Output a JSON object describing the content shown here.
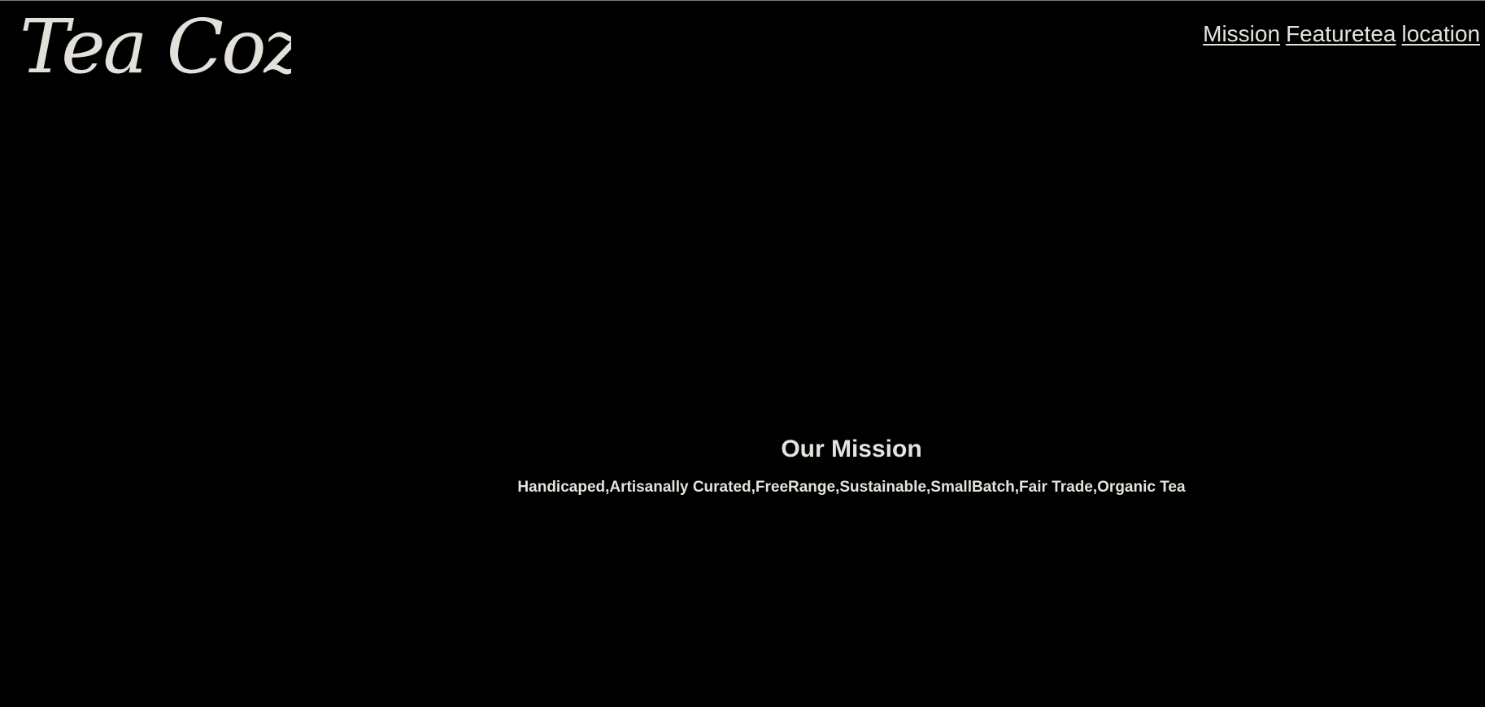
{
  "brand": {
    "logo_text": "Tea Cozy"
  },
  "nav": {
    "items": [
      {
        "label": "Mission"
      },
      {
        "label": "Featuretea"
      },
      {
        "label": "location"
      }
    ]
  },
  "mission": {
    "title": "Our Mission",
    "tagline": "Handicaped,Artisanally Curated,FreeRange,Sustainable,SmallBatch,Fair Trade,Organic Tea"
  },
  "colors": {
    "background": "#000000",
    "text": "#e6e2dd"
  }
}
